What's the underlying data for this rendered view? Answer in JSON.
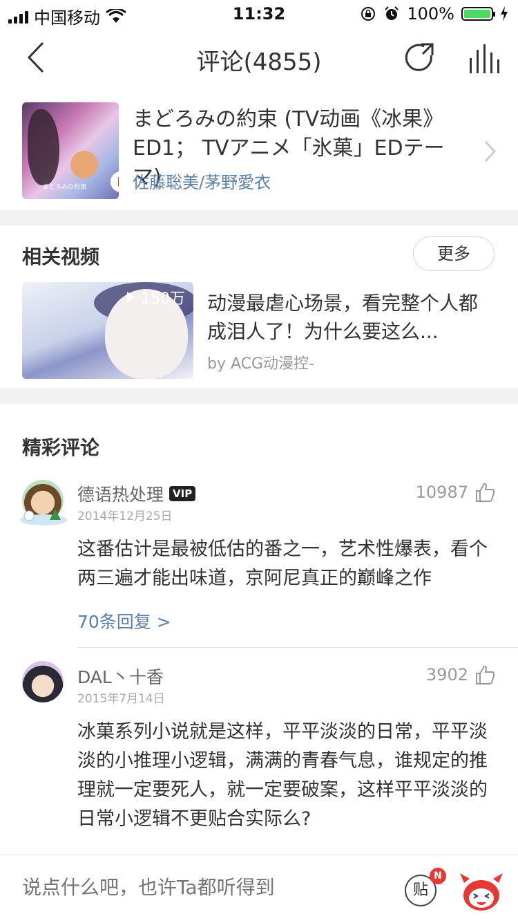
{
  "status_bar": {
    "carrier": "中国移动",
    "time": "11:32",
    "battery": "100%"
  },
  "nav": {
    "title": "评论(4855)"
  },
  "song": {
    "title": "まどろみの約束 (TV动画《冰果》ED1； TVアニメ「氷菓」EDテーマ)",
    "artist": "佐藤聡美/茅野愛衣",
    "cover_caption": "まどろみの約束"
  },
  "related_videos": {
    "heading": "相关视频",
    "more_label": "更多",
    "video": {
      "views": "150万",
      "title": "动漫最虐心场景，看完整个人都成泪人了！为什么要这么...",
      "by": "by ACG动漫控-"
    }
  },
  "hot_comments": {
    "heading": "精彩评论",
    "items": [
      {
        "user": "德语热处理",
        "badge": "VIP",
        "date": "2014年12月25日",
        "likes": "10987",
        "text": "这番估计是最被低估的番之一，艺术性爆表，看个两三遍才能出味道，京阿尼真正的巅峰之作",
        "replies": "70条回复 >"
      },
      {
        "user": "DAL丶十香",
        "date": "2015年7月14日",
        "likes": "3902",
        "text": "冰菓系列小说就是这样，平平淡淡的日常，平平淡淡的小推理小逻辑，满满的青春气息，谁规定的推理就一定要死人，就一定要破案，这样平平淡淡的日常小逻辑不更贴合实际么?"
      }
    ]
  },
  "bottom_bar": {
    "input_placeholder": "说点什么吧，也许Ta都听得到",
    "sticker_label": "贴",
    "badge": "N"
  },
  "colors": {
    "link_blue": "#5b7fa8",
    "battery_green": "#4cd964",
    "badge_red": "#e53935"
  }
}
